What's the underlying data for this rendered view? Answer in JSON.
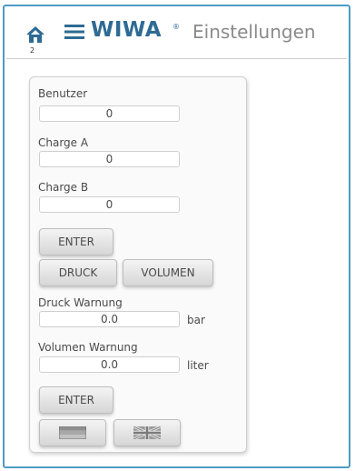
{
  "header": {
    "home_badge": "2",
    "brand": "WIWA",
    "brand_mark": "®",
    "title": "Einstellungen"
  },
  "panel": {
    "benutzer": {
      "label": "Benutzer",
      "value": "0"
    },
    "charge_a": {
      "label": "Charge A",
      "value": "0"
    },
    "charge_b": {
      "label": "Charge B",
      "value": "0"
    },
    "enter_label": "ENTER",
    "mode_buttons": {
      "druck": "DRUCK",
      "volumen": "VOLUMEN"
    },
    "druck_warnung": {
      "label": "Druck Warnung",
      "value": "0.0",
      "unit": "bar"
    },
    "volumen_warnung": {
      "label": "Volumen Warnung",
      "value": "0.0",
      "unit": "liter"
    },
    "enter2_label": "ENTER",
    "language_buttons": [
      {
        "icon": "german-flag-icon"
      },
      {
        "icon": "uk-flag-icon"
      }
    ]
  },
  "colors": {
    "frame_border": "#4e9bc6",
    "brand": "#2e6b94",
    "text": "#4a4a4a"
  }
}
